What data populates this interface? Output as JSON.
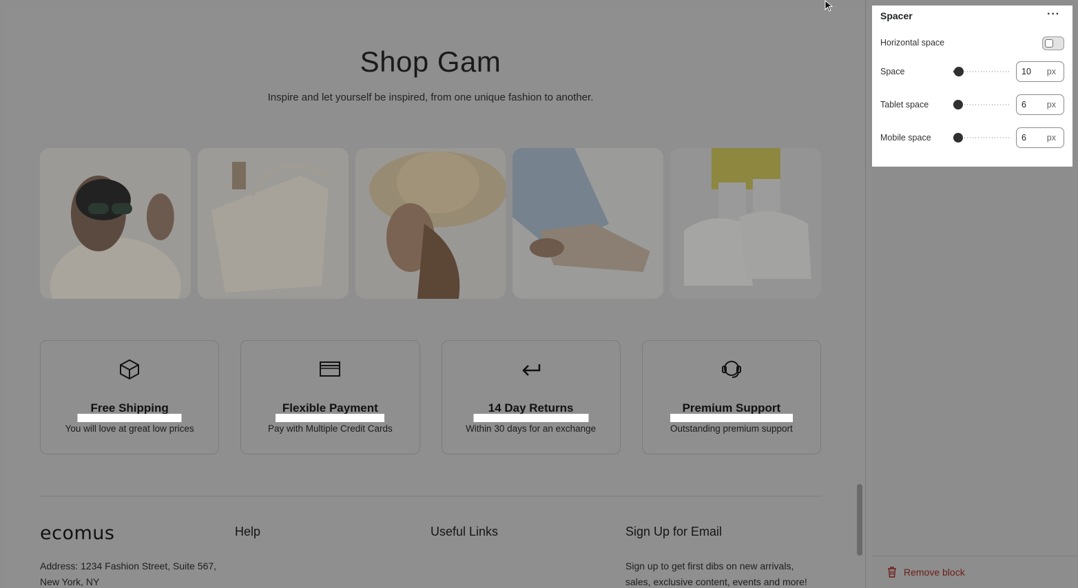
{
  "preview": {
    "heading": "Shop Gam",
    "subheading": "Inspire and let yourself be inspired, from one unique fashion to another.",
    "gallery": [
      {
        "icon": "photo-sunglasses"
      },
      {
        "icon": "photo-handbag"
      },
      {
        "icon": "photo-straw-hat"
      },
      {
        "icon": "photo-slip-on-shoes"
      },
      {
        "icon": "photo-chunky-sneakers"
      }
    ],
    "features": [
      {
        "icon": "box-icon",
        "title": "Free Shipping",
        "desc": "You will love at great low prices"
      },
      {
        "icon": "credit-card-icon",
        "title": "Flexible Payment",
        "desc": "Pay with Multiple Credit Cards"
      },
      {
        "icon": "return-arrow-icon",
        "title": "14 Day Returns",
        "desc": "Within 30 days for an exchange"
      },
      {
        "icon": "headset-icon",
        "title": "Premium Support",
        "desc": "Outstanding premium support"
      }
    ],
    "footer": {
      "logo": "ecomus",
      "col_help": "Help",
      "col_links": "Useful Links",
      "col_signup": "Sign Up for Email",
      "address_line1": "Address: 1234 Fashion Street, Suite 567,",
      "address_line2": "New York, NY",
      "signup_line1": "Sign up to get first dibs on new arrivals,",
      "signup_line2": "sales, exclusive content, events and more!"
    }
  },
  "panel": {
    "title": "Spacer",
    "more_label": "···",
    "horizontal_label": "Horizontal space",
    "horizontal_on": false,
    "rows": [
      {
        "label": "Space",
        "value": "10",
        "unit": "px",
        "slider_fraction": 0.1
      },
      {
        "label": "Tablet space",
        "value": "6",
        "unit": "px",
        "slider_fraction": 0.06
      },
      {
        "label": "Mobile space",
        "value": "6",
        "unit": "px",
        "slider_fraction": 0.06
      }
    ],
    "remove_label": "Remove block"
  },
  "colors": {
    "overlay": "#8f8f8f",
    "panel_bg": "#ffffff",
    "remove": "#6b1d16",
    "slider": "#303030"
  }
}
